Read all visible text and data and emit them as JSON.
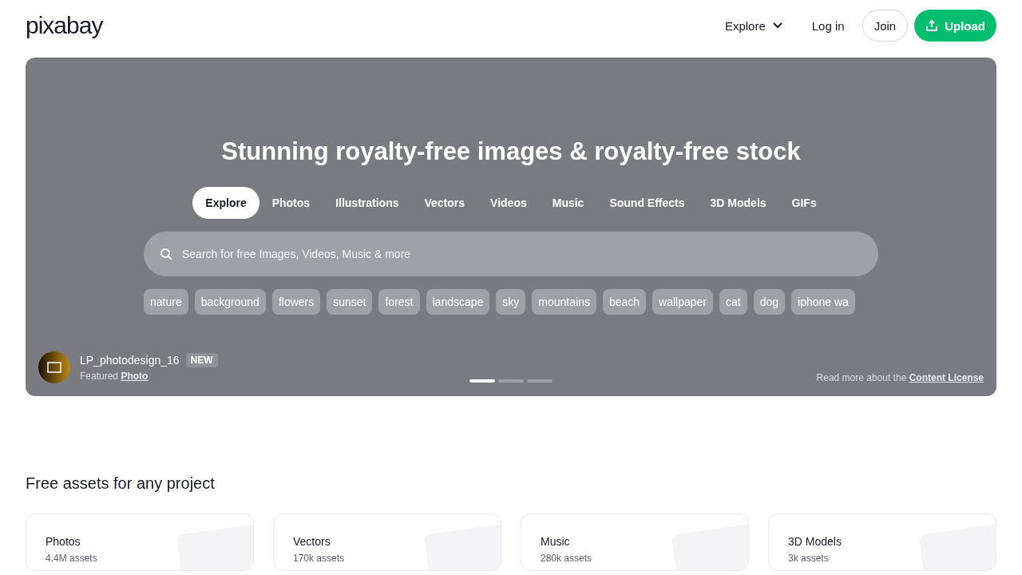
{
  "header": {
    "logo": "pixabay",
    "nav": [
      {
        "label": "Explore",
        "kind": "menu"
      },
      {
        "label": "Log in",
        "kind": "link"
      },
      {
        "label": "Join",
        "kind": "outline"
      },
      {
        "label": "Upload",
        "kind": "primary"
      }
    ]
  },
  "hero": {
    "title": "Stunning royalty-free images & royalty-free stock",
    "tabs": [
      {
        "label": "Explore",
        "selected": true
      },
      {
        "label": "Photos",
        "selected": false
      },
      {
        "label": "Illustrations",
        "selected": false
      },
      {
        "label": "Vectors",
        "selected": false
      },
      {
        "label": "Videos",
        "selected": false
      },
      {
        "label": "Music",
        "selected": false
      },
      {
        "label": "Sound Effects",
        "selected": false
      },
      {
        "label": "3D Models",
        "selected": false
      },
      {
        "label": "GIFs",
        "selected": false
      }
    ],
    "search": {
      "placeholder": "Search for free Images, Videos, Music & more"
    },
    "tags": [
      "nature",
      "background",
      "flowers",
      "sunset",
      "forest",
      "landscape",
      "sky",
      "mountains",
      "beach",
      "wallpaper",
      "cat",
      "dog",
      "iphone wa"
    ],
    "featured": {
      "user": "LP_photodesign_16",
      "badge": "NEW",
      "caption": "Featured",
      "link": "Photo"
    },
    "slides": [
      {
        "selected": true
      },
      {
        "selected": false
      },
      {
        "selected": false
      }
    ],
    "license": {
      "text": "Read more about the",
      "link": "Content License"
    }
  },
  "assets": {
    "heading": "Free assets for any project",
    "cards": [
      {
        "title": "Photos",
        "count": "4.4M assets"
      },
      {
        "title": "Vectors",
        "count": "170k assets"
      },
      {
        "title": "Music",
        "count": "280k assets"
      },
      {
        "title": "3D Models",
        "count": "3k assets"
      }
    ]
  }
}
